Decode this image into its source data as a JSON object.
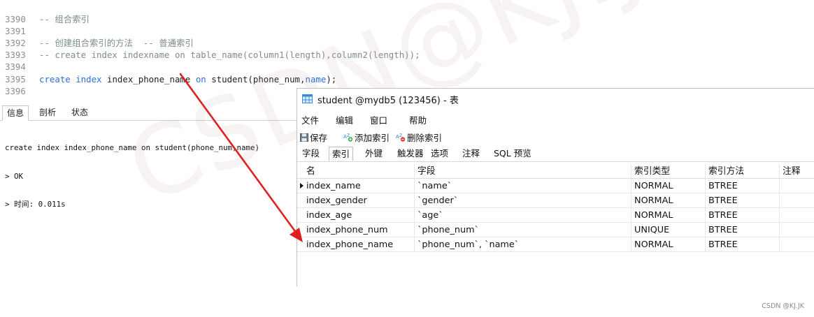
{
  "editor": {
    "lines": [
      {
        "num": "3390",
        "parts": [
          {
            "t": "-- 组合索引",
            "c": "cmt"
          }
        ]
      },
      {
        "num": "3391",
        "parts": []
      },
      {
        "num": "3392",
        "parts": [
          {
            "t": "-- 创建组合索引的方法  -- 普通索引",
            "c": "cmt"
          }
        ]
      },
      {
        "num": "3393",
        "parts": [
          {
            "t": "-- create index indexname on table_name(column1(length),column2(length));",
            "c": "cmt"
          }
        ]
      },
      {
        "num": "3394",
        "parts": []
      },
      {
        "num": "3395",
        "parts": [
          {
            "t": "create index ",
            "c": "kw"
          },
          {
            "t": "index_phone_name ",
            "c": "id"
          },
          {
            "t": "on ",
            "c": "kw"
          },
          {
            "t": "student(phone_num,",
            "c": "id"
          },
          {
            "t": "name",
            "c": "kw"
          },
          {
            "t": ");",
            "c": "id"
          }
        ]
      },
      {
        "num": "3396",
        "parts": []
      }
    ]
  },
  "result_panel": {
    "tabs": [
      "信息",
      "剖析",
      "状态"
    ],
    "active_tab": "信息",
    "lines": [
      "create index index_phone_name on student(phone_num,name)",
      "> OK",
      "> 时间: 0.011s"
    ]
  },
  "design_window": {
    "title": "student @mydb5 (123456) - 表",
    "menu": [
      "文件",
      "编辑",
      "窗口",
      "帮助"
    ],
    "toolbar": {
      "save_label": "保存",
      "add_index_label": "添加索引",
      "delete_index_label": "删除索引"
    },
    "tabs": [
      "字段",
      "索引",
      "外键",
      "触发器",
      "选项",
      "注释",
      "SQL 预览"
    ],
    "active_tab": "索引",
    "grid": {
      "headers": [
        "名",
        "字段",
        "索引类型",
        "索引方法",
        "注释"
      ],
      "rows": [
        {
          "name": "index_name",
          "fields": "`name`",
          "type": "NORMAL",
          "method": "BTREE",
          "comment": ""
        },
        {
          "name": "index_gender",
          "fields": "`gender`",
          "type": "NORMAL",
          "method": "BTREE",
          "comment": ""
        },
        {
          "name": "index_age",
          "fields": "`age`",
          "type": "NORMAL",
          "method": "BTREE",
          "comment": ""
        },
        {
          "name": "index_phone_num",
          "fields": "`phone_num`",
          "type": "UNIQUE",
          "method": "BTREE",
          "comment": ""
        },
        {
          "name": "index_phone_name",
          "fields": "`phone_num`, `name`",
          "type": "NORMAL",
          "method": "BTREE",
          "comment": ""
        }
      ],
      "current_row": 0
    }
  },
  "watermark": "CSDN@KJ.JK",
  "footer_credit": "CSDN @KJ.JK",
  "colors": {
    "keyword": "#2a6fdb",
    "comment": "#7f8c8d",
    "arrow": "#e02020"
  }
}
